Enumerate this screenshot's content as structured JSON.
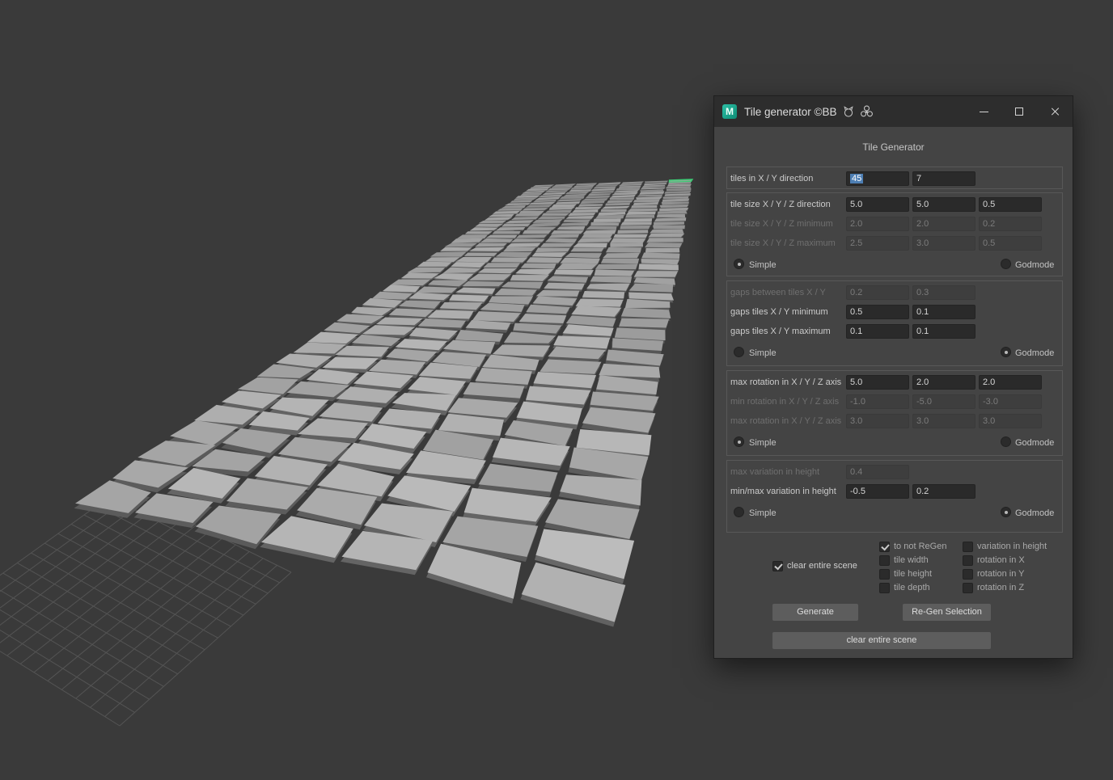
{
  "viewport": {
    "scene": {
      "tiles_long": 45,
      "tiles_wide": 7,
      "colors": {
        "background": "#3a3a3a",
        "tile": "#a8a8a8",
        "selected_outline": "#3fd078",
        "grid_line": "#545454"
      }
    }
  },
  "window": {
    "titlebar": {
      "title": "Tile generator ©BB"
    },
    "header": "Tile Generator",
    "rows": {
      "tiles_xy": {
        "label": "tiles in X / Y direction",
        "values": [
          "45",
          "7"
        ]
      },
      "size_dir": {
        "label": "tile size X / Y / Z direction",
        "values": [
          "5.0",
          "5.0",
          "0.5"
        ]
      },
      "size_min": {
        "label": "tile size X / Y / Z minimum",
        "values": [
          "2.0",
          "2.0",
          "0.2"
        ]
      },
      "size_max": {
        "label": "tile size X / Y / Z maximum",
        "values": [
          "2.5",
          "3.0",
          "0.5"
        ]
      },
      "gaps": {
        "label": "gaps between tiles X / Y",
        "values": [
          "0.2",
          "0.3"
        ]
      },
      "gaps_min": {
        "label": "gaps tiles X / Y minimum",
        "values": [
          "0.5",
          "0.1"
        ]
      },
      "gaps_max": {
        "label": "gaps tiles X / Y maximum",
        "values": [
          "0.1",
          "0.1"
        ]
      },
      "rot_dir": {
        "label": "max rotation in X / Y / Z axis",
        "values": [
          "5.0",
          "2.0",
          "2.0"
        ]
      },
      "rot_min": {
        "label": "min rotation in X / Y / Z axis",
        "values": [
          "-1.0",
          "-5.0",
          "-3.0"
        ]
      },
      "rot_max": {
        "label": "max rotation in X / Y / Z axis",
        "values": [
          "3.0",
          "3.0",
          "3.0"
        ]
      },
      "height_max": {
        "label": "max variation in height",
        "values": [
          "0.4"
        ]
      },
      "height_minmax": {
        "label": "min/max variation in height",
        "values": [
          "-0.5",
          "0.2"
        ]
      }
    },
    "radio": {
      "simple": "Simple",
      "godmode": "Godmode"
    },
    "radio_state": {
      "size_simple": true,
      "size_godmode": false,
      "gaps_simple": false,
      "gaps_godmode": true,
      "rotation_simple": true,
      "rotation_godmode": false,
      "height_simple": false,
      "height_godmode": true
    },
    "checkboxes": {
      "clear_scene": {
        "label": "clear entire scene",
        "checked": true
      },
      "to_not_regen": {
        "label": "to not ReGen",
        "checked": true
      },
      "tile_width": {
        "label": "tile width",
        "checked": false
      },
      "tile_height": {
        "label": "tile height",
        "checked": false
      },
      "tile_depth": {
        "label": "tile depth",
        "checked": false
      },
      "variation_height": {
        "label": "variation in height",
        "checked": false
      },
      "rotation_x": {
        "label": "rotation in X",
        "checked": false
      },
      "rotation_y": {
        "label": "rotation in Y",
        "checked": false
      },
      "rotation_z": {
        "label": "rotation in Z",
        "checked": false
      }
    },
    "buttons": {
      "generate": "Generate",
      "regen": "Re-Gen Selection",
      "clear": "clear entire scene"
    }
  }
}
